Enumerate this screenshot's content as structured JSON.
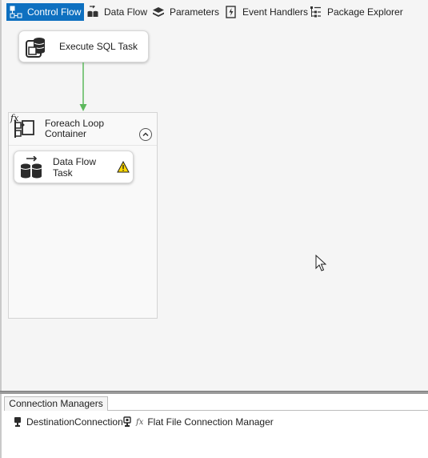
{
  "tabs": [
    {
      "label": "Control Flow",
      "icon": "control-flow-icon",
      "active": true
    },
    {
      "label": "Data Flow",
      "icon": "data-flow-icon",
      "active": false
    },
    {
      "label": "Parameters",
      "icon": "parameters-icon",
      "active": false
    },
    {
      "label": "Event Handlers",
      "icon": "event-handlers-icon",
      "active": false
    },
    {
      "label": "Package Explorer",
      "icon": "package-explorer-icon",
      "active": false
    }
  ],
  "canvas": {
    "execute_sql_task": {
      "label": "Execute SQL Task",
      "icon": "execute-sql-task-icon"
    },
    "precedence_constraint": {
      "color": "#5cb85c"
    },
    "foreach_container": {
      "label": "Foreach Loop Container",
      "expression_badge": "fx",
      "collapse_icon": "chevron-up-circle-icon"
    },
    "data_flow_task": {
      "label": "Data Flow Task",
      "icon": "data-flow-task-icon",
      "warning_icon": "warning-icon"
    }
  },
  "connection_managers": {
    "tab_label": "Connection Managers",
    "items": [
      {
        "label": "DestinationConnection",
        "icon": "connection-icon"
      },
      {
        "label": "Flat File Connection Manager",
        "icon": "connection-icon",
        "badge": "fx"
      }
    ]
  },
  "colors": {
    "active_tab": "#0e70c0",
    "surface": "#f5f5f5",
    "success_arrow": "#5cb85c",
    "warning": "#ffd800"
  }
}
